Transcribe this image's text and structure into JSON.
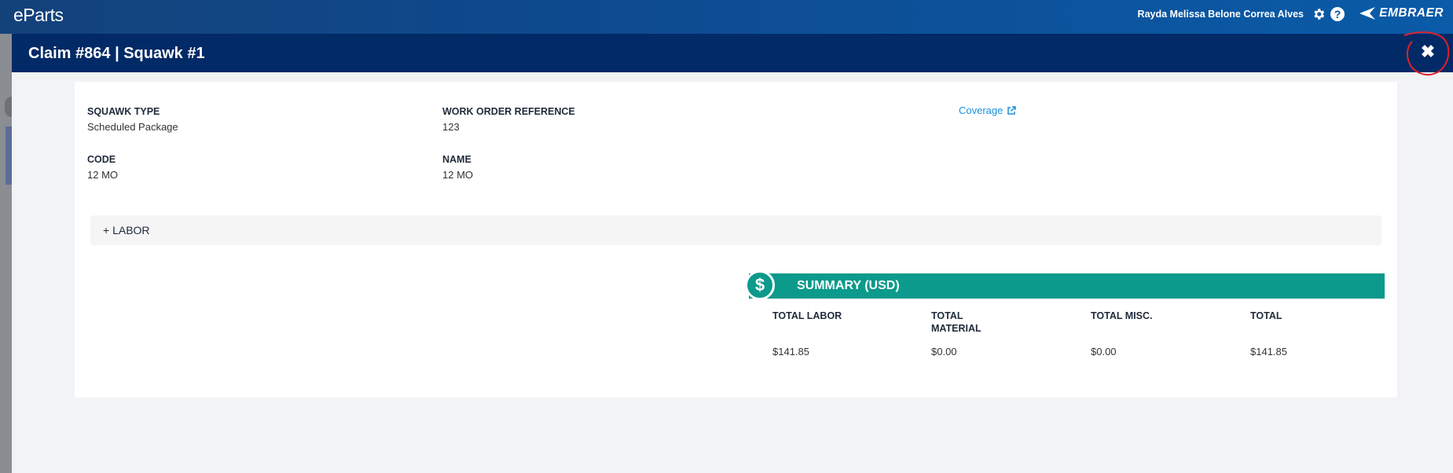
{
  "app": {
    "brand": "eParts",
    "user": "Rayda Melissa Belone Correa Alves",
    "company": "EMBRAER"
  },
  "modal": {
    "title": "Claim #864 | Squawk #1",
    "close_label": "✖",
    "fields": {
      "squawk_type": {
        "label": "SQUAWK TYPE",
        "value": "Scheduled Package"
      },
      "work_order": {
        "label": "WORK ORDER REFERENCE",
        "value": "123"
      },
      "code": {
        "label": "CODE",
        "value": "12 MO"
      },
      "name": {
        "label": "NAME",
        "value": "12 MO"
      }
    },
    "coverage_link": "Coverage",
    "labor_toggle": "+ LABOR",
    "summary": {
      "title": "SUMMARY (USD)",
      "icon_glyph": "$",
      "columns": [
        {
          "label": "TOTAL LABOR",
          "value": "$141.85"
        },
        {
          "label": "TOTAL MATERIAL",
          "value": "$0.00"
        },
        {
          "label": "TOTAL MISC.",
          "value": "$0.00"
        },
        {
          "label": "TOTAL",
          "value": "$141.85"
        }
      ]
    }
  },
  "colors": {
    "header": "#022a66",
    "accent_teal": "#0b9a8b",
    "link": "#1a8fe0",
    "annotation": "#e0202a"
  },
  "icons": [
    "gear-icon",
    "help-icon",
    "embraer-logo-icon",
    "close-icon",
    "external-link-icon",
    "dollar-icon"
  ]
}
